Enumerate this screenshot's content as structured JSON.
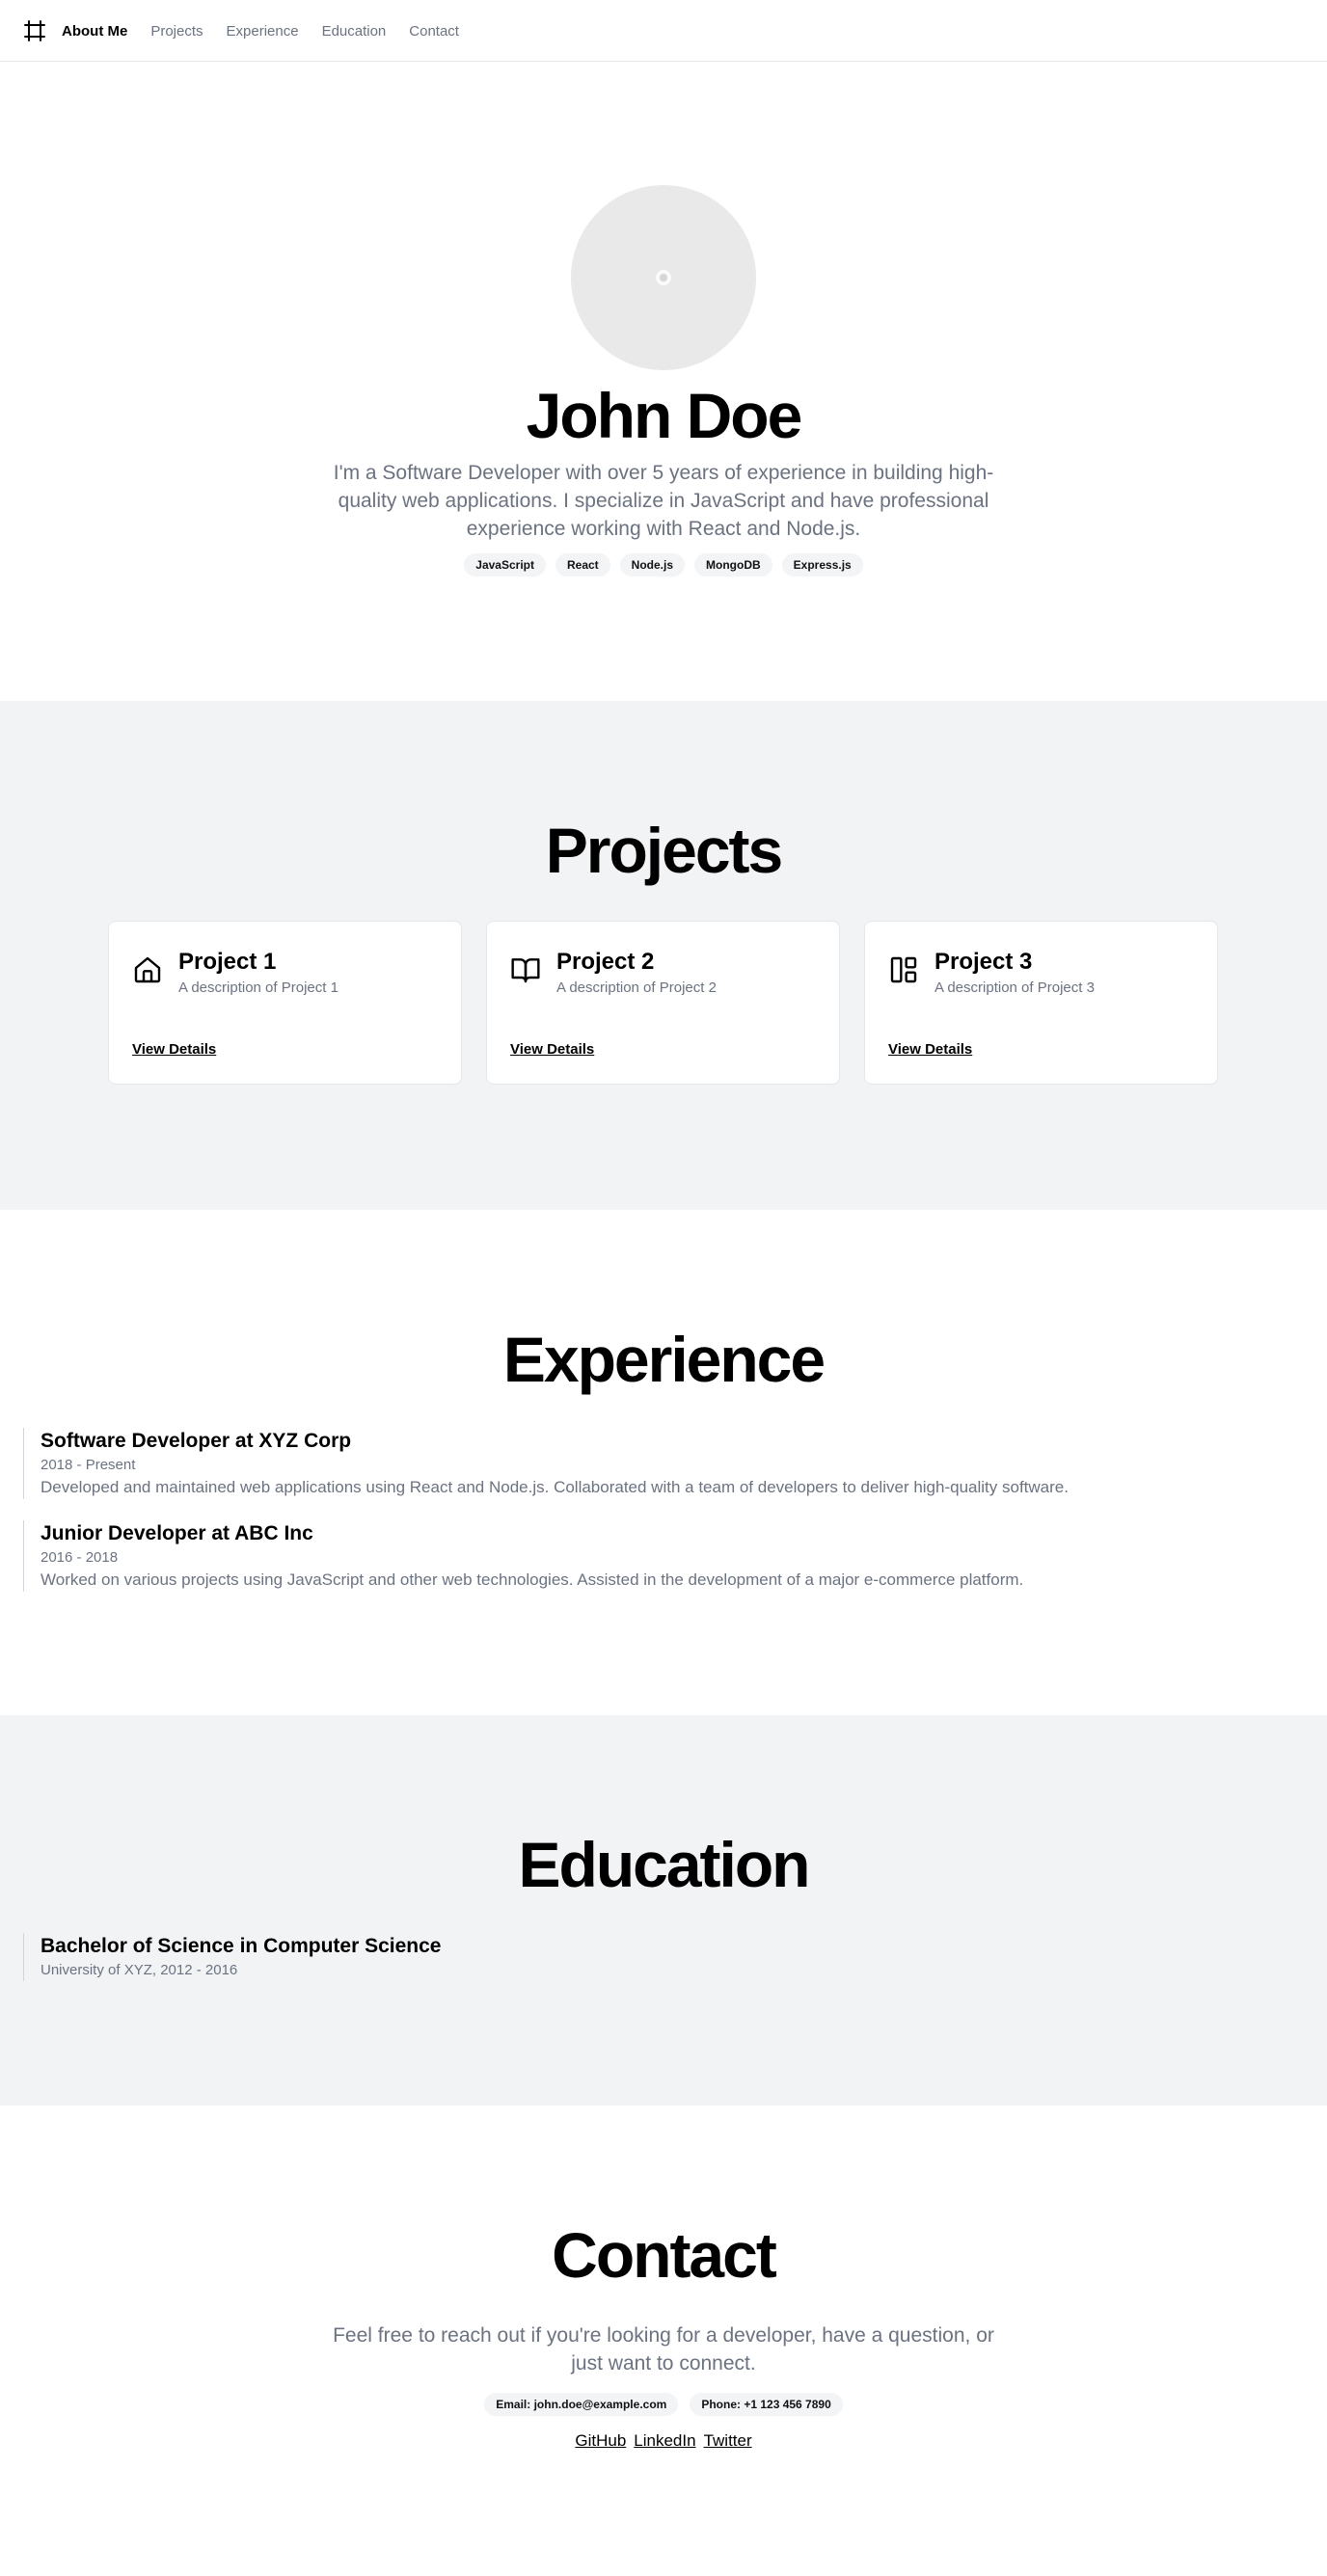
{
  "header": {
    "logo_icon": "frame-icon",
    "nav": [
      {
        "label": "About Me",
        "active": true
      },
      {
        "label": "Projects",
        "active": false
      },
      {
        "label": "Experience",
        "active": false
      },
      {
        "label": "Education",
        "active": false
      },
      {
        "label": "Contact",
        "active": false
      }
    ]
  },
  "hero": {
    "avatar_icon": "avatar-placeholder-icon",
    "name": "John Doe",
    "bio": "I'm a Software Developer with over 5 years of experience in building high-quality web applications. I specialize in JavaScript and have professional experience working with React and Node.js.",
    "skills": [
      "JavaScript",
      "React",
      "Node.js",
      "MongoDB",
      "Express.js"
    ]
  },
  "projects": {
    "title": "Projects",
    "items": [
      {
        "icon": "home-icon",
        "title": "Project 1",
        "description": "A description of Project 1",
        "link": "View Details"
      },
      {
        "icon": "book-open-icon",
        "title": "Project 2",
        "description": "A description of Project 2",
        "link": "View Details"
      },
      {
        "icon": "layout-icon",
        "title": "Project 3",
        "description": "A description of Project 3",
        "link": "View Details"
      }
    ]
  },
  "experience": {
    "title": "Experience",
    "items": [
      {
        "title": "Software Developer at XYZ Corp",
        "dates": "2018 - Present",
        "description": "Developed and maintained web applications using React and Node.js. Collaborated with a team of developers to deliver high-quality software."
      },
      {
        "title": "Junior Developer at ABC Inc",
        "dates": "2016 - 2018",
        "description": "Worked on various projects using JavaScript and other web technologies. Assisted in the development of a major e-commerce platform."
      }
    ]
  },
  "education": {
    "title": "Education",
    "items": [
      {
        "title": "Bachelor of Science in Computer Science",
        "details": "University of XYZ, 2012 - 2016"
      }
    ]
  },
  "contact": {
    "title": "Contact",
    "text": "Feel free to reach out if you're looking for a developer, have a question, or just want to connect.",
    "email": "Email: john.doe@example.com",
    "phone": "Phone: +1 123 456 7890",
    "links": [
      "GitHub",
      "LinkedIn",
      "Twitter"
    ]
  },
  "colors": {
    "muted_text": "#6b7280",
    "section_alt_bg": "#f2f3f5",
    "tag_bg": "#f3f4f6",
    "border": "#e5e7eb"
  }
}
